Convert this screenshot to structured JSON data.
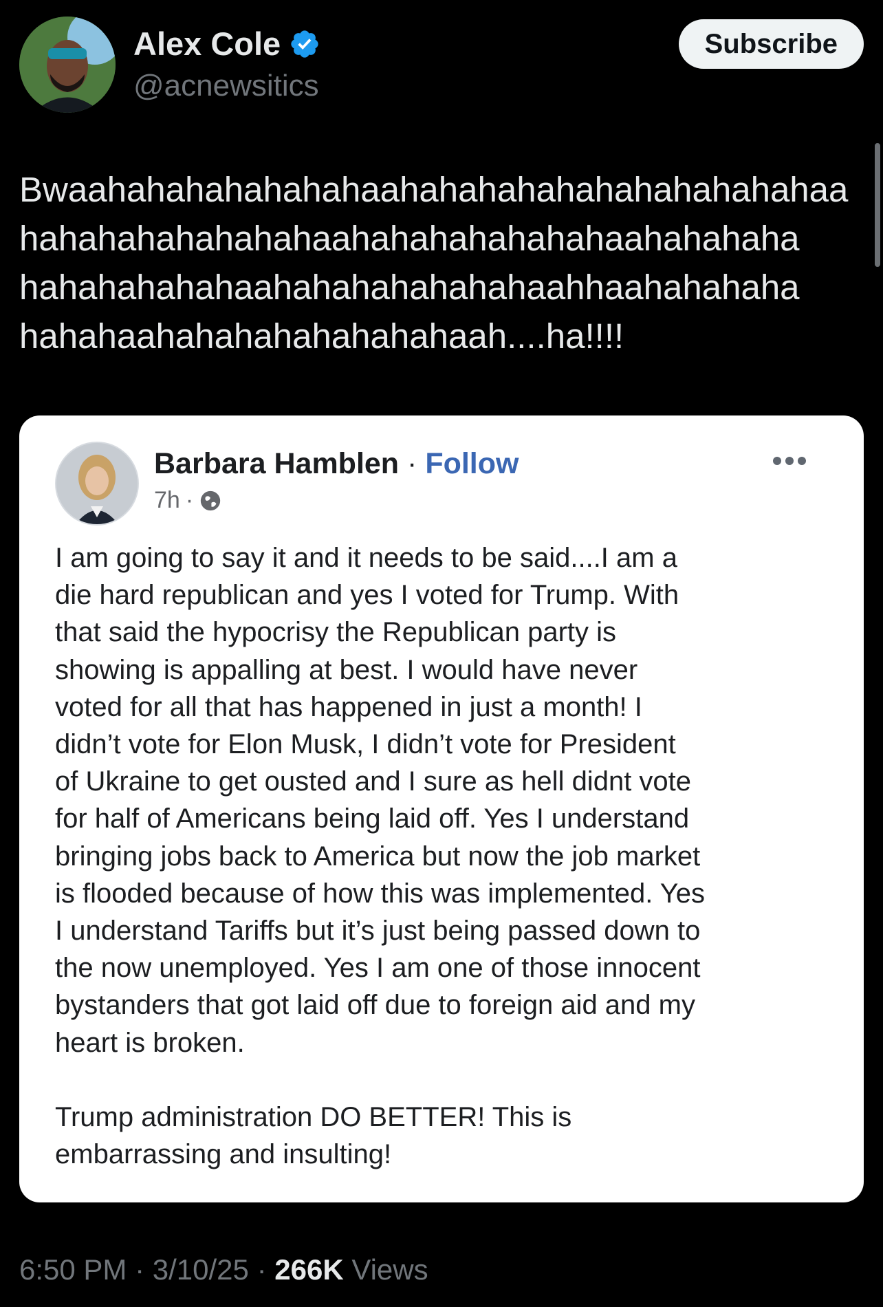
{
  "tweet": {
    "author": {
      "display_name": "Alex Cole",
      "handle": "@acnewsitics",
      "verified": true,
      "avatar_icon": "user-avatar-photo"
    },
    "subscribe_label": "Subscribe",
    "text": "Bwaahahahahahahahaahahahahahahahahahahahaa\nhahahahahahahahaahahahahahahahaahahahaha\nhahahahahahaahahahahahahahaahhaahahahaha\nhahahaahahahahahahahahaah....ha!!!!",
    "timestamp": "6:50 PM",
    "date": "3/10/25",
    "separator": "·",
    "views_count": "266K",
    "views_label": "Views"
  },
  "quoted_post": {
    "author": "Barbara Hamblen",
    "separator": "·",
    "follow_label": "Follow",
    "age": "7h",
    "meta_separator": "·",
    "visibility_icon": "globe-icon",
    "more_icon": "more-dots-icon",
    "body": "I am going to say it and it needs to be said....I am a\ndie hard republican and yes I voted for Trump. With\nthat said the hypocrisy the Republican party is\nshowing is appalling at best. I would have never\nvoted for all that has happened in just a month! I\ndidn’t vote for Elon Musk, I didn’t vote for President\nof Ukraine to get ousted and I sure as hell didnt vote\nfor half of Americans being laid off.  Yes I understand\nbringing jobs back to America but now the job market\nis flooded because of how this was implemented. Yes\nI understand Tariffs but it’s just being passed down to\nthe now unemployed. Yes I am one of those innocent\nbystanders that got laid off due to foreign aid and my\nheart is broken.\n\nTrump administration DO BETTER! This is\nembarrassing and insulting!"
  },
  "colors": {
    "background": "#000000",
    "primary_text": "#e7e9ea",
    "secondary_text": "#71767b",
    "verified_blue": "#1d9bf0",
    "follow_blue": "#3b67b3",
    "card_background": "#ffffff"
  }
}
